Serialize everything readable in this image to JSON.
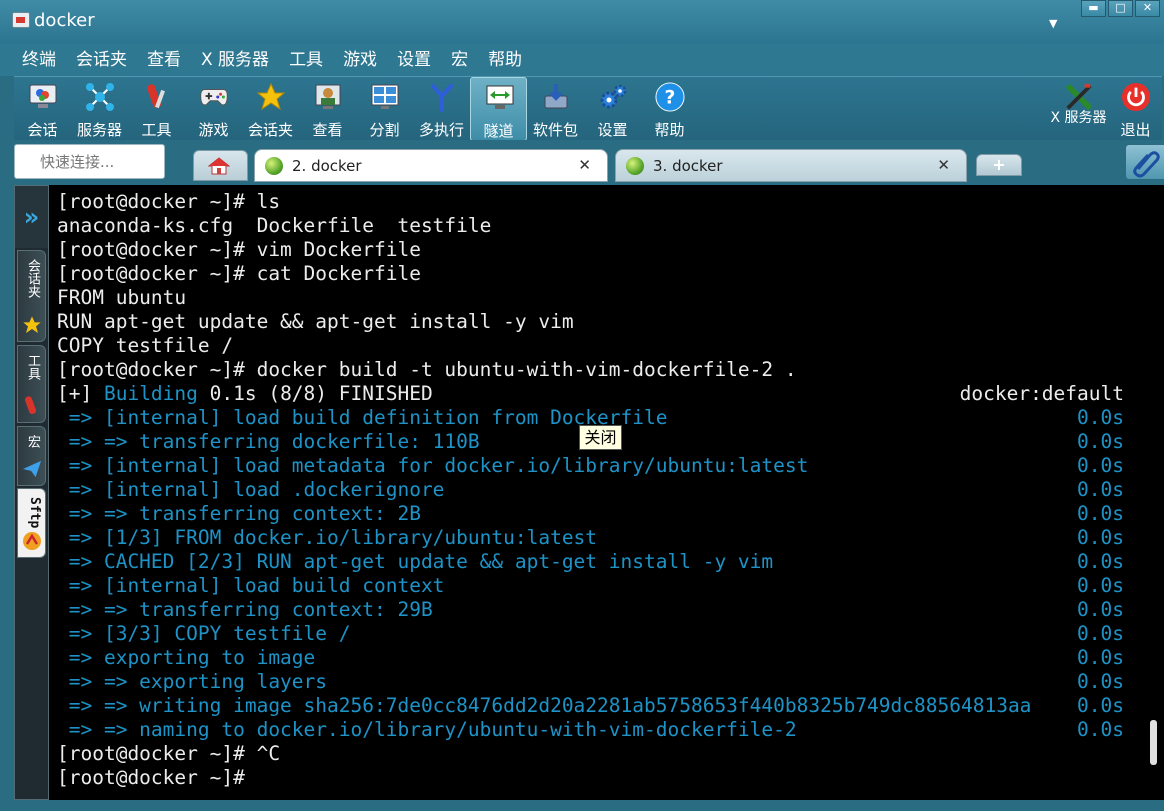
{
  "window": {
    "title": "docker",
    "menu_glyph": "▼",
    "buttons": {
      "minimize": "▬",
      "maximize": "□",
      "close": "✕"
    }
  },
  "menubar": [
    "终端",
    "会话夹",
    "查看",
    "X 服务器",
    "工具",
    "游戏",
    "设置",
    "宏",
    "帮助"
  ],
  "toolbar": {
    "left": [
      {
        "label": "会话",
        "icon": "session-icon"
      },
      {
        "label": "服务器",
        "icon": "servers-icon"
      },
      {
        "label": "工具",
        "icon": "tools-icon"
      },
      {
        "label": "游戏",
        "icon": "games-icon"
      },
      {
        "label": "会话夹",
        "icon": "star-icon"
      },
      {
        "label": "查看",
        "icon": "view-icon"
      },
      {
        "label": "分割",
        "icon": "split-icon"
      },
      {
        "label": "多执行",
        "icon": "multi-exec-icon"
      },
      {
        "label": "隧道",
        "icon": "tunnel-icon",
        "active": true
      },
      {
        "label": "软件包",
        "icon": "packages-icon"
      },
      {
        "label": "设置",
        "icon": "settings-icon"
      },
      {
        "label": "帮助",
        "icon": "help-icon"
      }
    ],
    "right": [
      {
        "label": "X 服务器",
        "icon": "x-server-icon"
      },
      {
        "label": "退出",
        "icon": "power-icon"
      }
    ]
  },
  "tabs": {
    "quick_connect_placeholder": "快速连接...",
    "items": [
      {
        "label": "2. docker",
        "active": true,
        "close": "✕"
      },
      {
        "label": "3. docker",
        "active": false,
        "close": "✕"
      }
    ],
    "new_tab": "+"
  },
  "side_panel": {
    "expand": "»",
    "tabs": [
      {
        "label": "会话夹",
        "icon": "star-icon"
      },
      {
        "label": "工具",
        "icon": "tools-icon"
      },
      {
        "label": "宏",
        "icon": "paper-plane-icon"
      },
      {
        "label": "Sftp",
        "icon": "sftp-icon",
        "active": true
      }
    ]
  },
  "terminal": {
    "lines": [
      {
        "text": "[root@docker ~]# ls",
        "color": "white"
      },
      {
        "text": "anaconda-ks.cfg  Dockerfile  testfile",
        "color": "white"
      },
      {
        "text": "[root@docker ~]# vim Dockerfile",
        "color": "white"
      },
      {
        "text": "[root@docker ~]# cat Dockerfile",
        "color": "white"
      },
      {
        "text": "FROM ubuntu",
        "color": "white"
      },
      {
        "text": "RUN apt-get update && apt-get install -y vim",
        "color": "white"
      },
      {
        "text": "COPY testfile /",
        "color": "white"
      },
      {
        "text": "[root@docker ~]# docker build -t ubuntu-with-vim-dockerfile-2 .",
        "color": "white"
      },
      {
        "prefix": "[+] ",
        "highlight": "Building",
        "suffix": " 0.1s (8/8) FINISHED",
        "right": "docker:default",
        "right_color": "white",
        "color": "white"
      },
      {
        "text": " => [internal] load build definition from Dockerfile",
        "right": "0.0s",
        "color": "blue"
      },
      {
        "text": " => => transferring dockerfile: 110B",
        "right": "0.0s",
        "color": "blue"
      },
      {
        "text": " => [internal] load metadata for docker.io/library/ubuntu:latest",
        "right": "0.0s",
        "color": "blue"
      },
      {
        "text": " => [internal] load .dockerignore",
        "right": "0.0s",
        "color": "blue"
      },
      {
        "text": " => => transferring context: 2B",
        "right": "0.0s",
        "color": "blue"
      },
      {
        "text": " => [1/3] FROM docker.io/library/ubuntu:latest",
        "right": "0.0s",
        "color": "blue"
      },
      {
        "text": " => CACHED [2/3] RUN apt-get update && apt-get install -y vim",
        "right": "0.0s",
        "color": "blue"
      },
      {
        "text": " => [internal] load build context",
        "right": "0.0s",
        "color": "blue"
      },
      {
        "text": " => => transferring context: 29B",
        "right": "0.0s",
        "color": "blue"
      },
      {
        "text": " => [3/3] COPY testfile /",
        "right": "0.0s",
        "color": "blue"
      },
      {
        "text": " => exporting to image",
        "right": "0.0s",
        "color": "blue"
      },
      {
        "text": " => => exporting layers",
        "right": "0.0s",
        "color": "blue"
      },
      {
        "text": " => => writing image sha256:7de0cc8476dd2d20a2281ab5758653f440b8325b749dc88564813aa",
        "right": "0.0s",
        "color": "blue"
      },
      {
        "text": " => => naming to docker.io/library/ubuntu-with-vim-dockerfile-2",
        "right": "0.0s",
        "color": "blue"
      },
      {
        "text": "[root@docker ~]# ^C",
        "color": "white"
      },
      {
        "text": "[root@docker ~]# ",
        "color": "white"
      }
    ],
    "tooltip": "关闭"
  }
}
